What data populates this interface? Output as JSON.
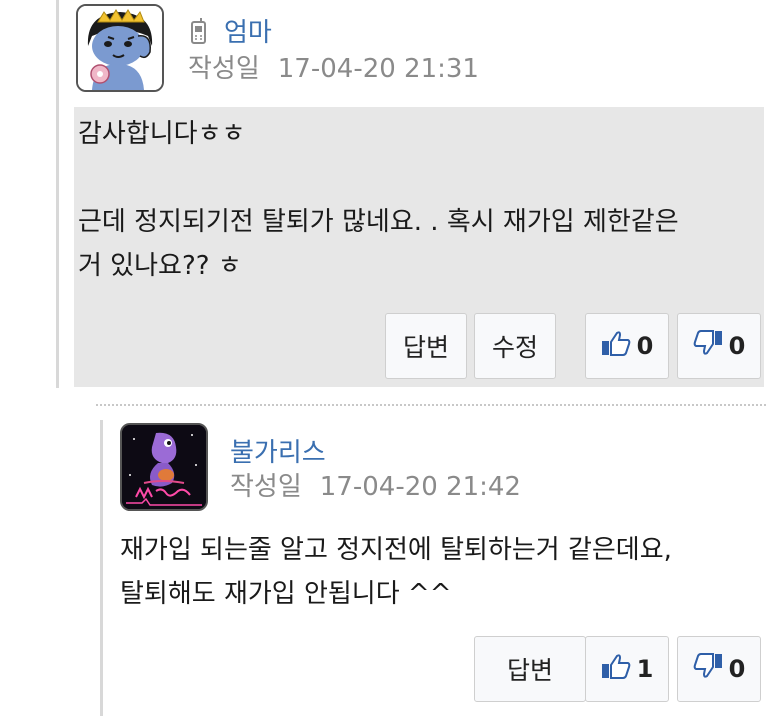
{
  "colors": {
    "author_link": "#3a6fb0",
    "meta_gray": "#8a8a8a",
    "box_bg": "#e7e7e7",
    "thumb_blue": "#2f5fa8"
  },
  "comments": [
    {
      "author": "엄마",
      "author_icon": "phone-icon",
      "date_label": "작성일",
      "date": "17-04-20 21:31",
      "body": [
        "감사합니다ㅎㅎ",
        "",
        "근데 정지되기전 탈퇴가 많네요. . 혹시 재가입 제한같은",
        "거 있나요?? ㅎ"
      ],
      "buttons": {
        "reply": "답변",
        "edit": "수정",
        "like_count": "0",
        "dislike_count": "0"
      }
    },
    {
      "author": "불가리스",
      "date_label": "작성일",
      "date": "17-04-20 21:42",
      "body": [
        "재가입 되는줄 알고 정지전에 탈퇴하는거 같은데요,",
        "탈퇴해도 재가입 안됩니다 ^^"
      ],
      "buttons": {
        "reply": "답변",
        "like_count": "1",
        "dislike_count": "0"
      }
    }
  ]
}
